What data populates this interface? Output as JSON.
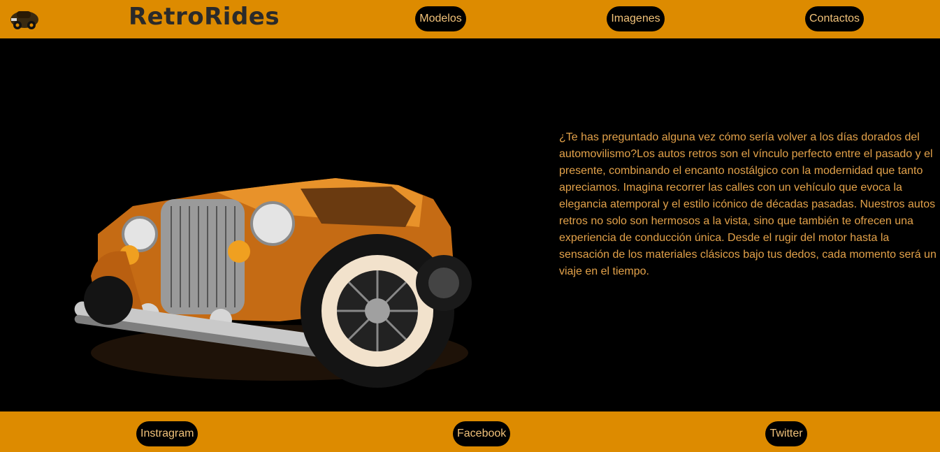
{
  "header": {
    "brand": "RetroRides",
    "nav": [
      {
        "label": "Modelos"
      },
      {
        "label": "Imagenes"
      },
      {
        "label": "Contactos"
      }
    ]
  },
  "main": {
    "intro_text": "¿Te has preguntado alguna vez cómo sería volver a los días dorados del automovilismo?Los autos retros son el vínculo perfecto entre el pasado y el presente, combinando el encanto nostálgico con la modernidad que tanto apreciamos. Imagina recorrer las calles con un vehículo que evoca la elegancia atemporal y el estilo icónico de décadas pasadas. Nuestros autos retros no solo son hermosos a la vista, sino que también te ofrecen una experiencia de conducción única. Desde el rugir del motor hasta la sensación de los materiales clásicos bajo tus dedos, cada momento será un viaje en el tiempo."
  },
  "footer": {
    "links": [
      {
        "label": "Instragram"
      },
      {
        "label": "Facebook"
      },
      {
        "label": "Twitter"
      }
    ]
  },
  "colors": {
    "accent": "#dd8b00",
    "text_on_dark": "#e3a24a",
    "pill_bg": "#000000",
    "pill_text": "#f1c27a",
    "background": "#000000"
  },
  "icons": {
    "logo": "retro-car-logo-icon",
    "hero": "retro-car-illustration"
  }
}
